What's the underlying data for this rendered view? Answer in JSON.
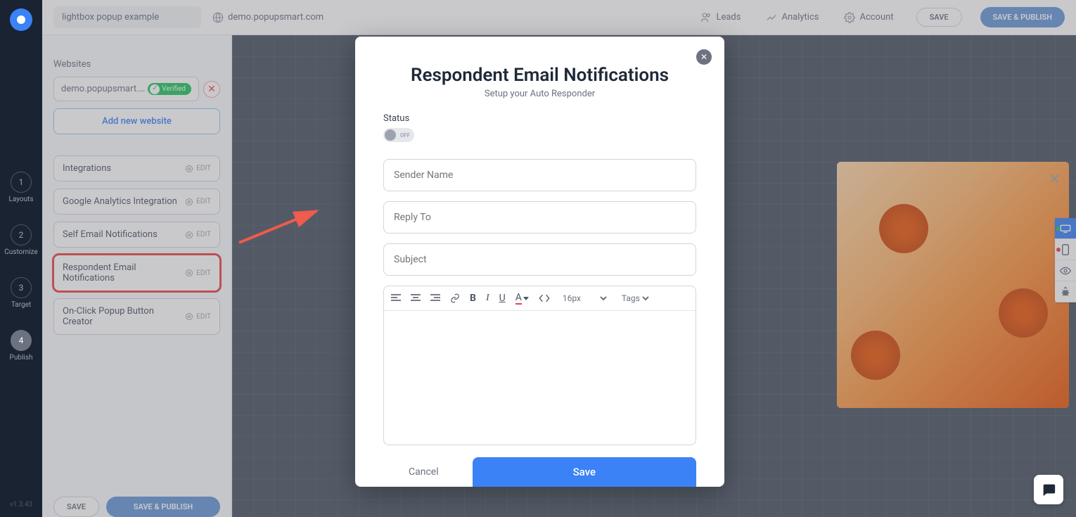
{
  "header": {
    "project_name": "lightbox popup example",
    "domain": "demo.popupsmart.com",
    "nav": {
      "leads": "Leads",
      "analytics": "Analytics",
      "account": "Account"
    },
    "save": "SAVE",
    "publish": "SAVE & PUBLISH"
  },
  "rail": {
    "steps": [
      {
        "num": "1",
        "label": "Layouts"
      },
      {
        "num": "2",
        "label": "Customize"
      },
      {
        "num": "3",
        "label": "Target"
      },
      {
        "num": "4",
        "label": "Publish"
      }
    ],
    "active": 3,
    "version": "v1.3.43"
  },
  "sidebar": {
    "websites_heading": "Websites",
    "website_value": "demo.popupsmart.c...",
    "verified": "Verified",
    "add_website": "Add new website",
    "edit_label": "EDIT",
    "rows": [
      {
        "label": "Integrations"
      },
      {
        "label": "Google Analytics Integration"
      },
      {
        "label": "Self Email Notifications"
      },
      {
        "label": "Respondent Email Notifications"
      },
      {
        "label": "On-Click Popup Button Creator"
      }
    ],
    "bottom_save": "SAVE",
    "bottom_publish": "SAVE & PUBLISH"
  },
  "modal": {
    "title": "Respondent Email Notifications",
    "subtitle": "Setup your Auto Responder",
    "status_label": "Status",
    "toggle_state": "OFF",
    "fields": {
      "sender_name": "Sender Name",
      "reply_to": "Reply To",
      "subject": "Subject"
    },
    "editor": {
      "font_size": "16px",
      "tags": "Tags"
    },
    "cancel": "Cancel",
    "save": "Save"
  }
}
